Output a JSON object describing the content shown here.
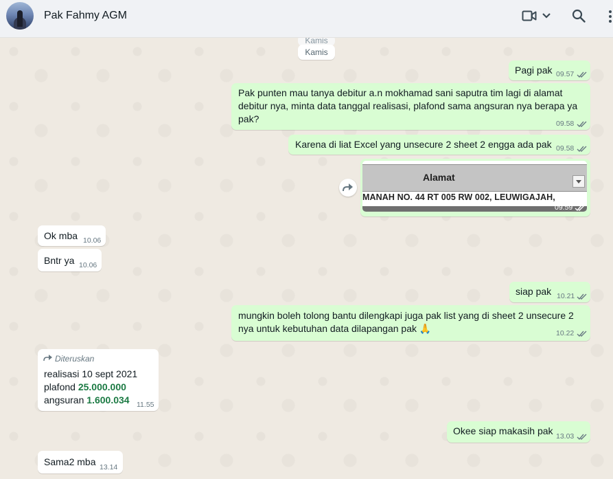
{
  "header": {
    "contact_name": "Pak Fahmy AGM",
    "icons": [
      "video-call-icon",
      "chevron-down-icon",
      "search-icon",
      "menu-icon"
    ]
  },
  "date_separators": [
    "Kamis",
    "Kamis"
  ],
  "messages": [
    {
      "dir": "out",
      "lines": [
        "Pagi pak"
      ],
      "time": "09.57",
      "status": "read"
    },
    {
      "dir": "out",
      "lines": [
        "Pak punten mau tanya debitur a.n mokhamad sani saputra tim lagi di alamat",
        "debitur nya, minta data tanggal realisasi, plafond sama angsuran nya berapa ya",
        "pak?"
      ],
      "time": "09.58",
      "status": "read"
    },
    {
      "dir": "out",
      "lines": [
        "Karena di liat Excel yang unsecure 2  sheet 2 engga ada pak"
      ],
      "time": "09.58",
      "status": "read"
    },
    {
      "dir": "out",
      "type": "image",
      "image": {
        "header": "Alamat",
        "row": "MANAH NO. 44 RT 005 RW 002, LEUWIGAJAH,"
      },
      "time": "09.59",
      "status": "read"
    },
    {
      "dir": "in",
      "lines": [
        "Ok mba"
      ],
      "time": "10.06"
    },
    {
      "dir": "in",
      "lines": [
        "Bntr ya"
      ],
      "time": "10.06"
    },
    {
      "dir": "out",
      "lines": [
        "siap pak"
      ],
      "time": "10.21",
      "status": "read"
    },
    {
      "dir": "out",
      "lines": [
        "mungkin boleh tolong bantu dilengkapi juga pak list yang di sheet 2 unsecure 2",
        "nya untuk kebutuhan data dilapangan pak 🙏"
      ],
      "time": "10.22",
      "status": "read"
    },
    {
      "dir": "in",
      "forwarded_label": "Diteruskan",
      "realisasi": "realisasi 10 sept 2021",
      "plafond_label": "plafond",
      "plafond_value": "25.000.000",
      "angsuran_label": "angsuran",
      "angsuran_value": "1.600.034",
      "time": "11.55"
    },
    {
      "dir": "out",
      "lines": [
        "Okee siap makasih pak"
      ],
      "time": "13.03",
      "status": "read"
    },
    {
      "dir": "in",
      "lines": [
        "Sama2 mba"
      ],
      "time": "13.14"
    }
  ],
  "colors": {
    "outgoing_bubble": "#d9fdd3",
    "incoming_bubble": "#ffffff",
    "read_tick": "#53bdeb",
    "chat_background": "#efeae2"
  }
}
